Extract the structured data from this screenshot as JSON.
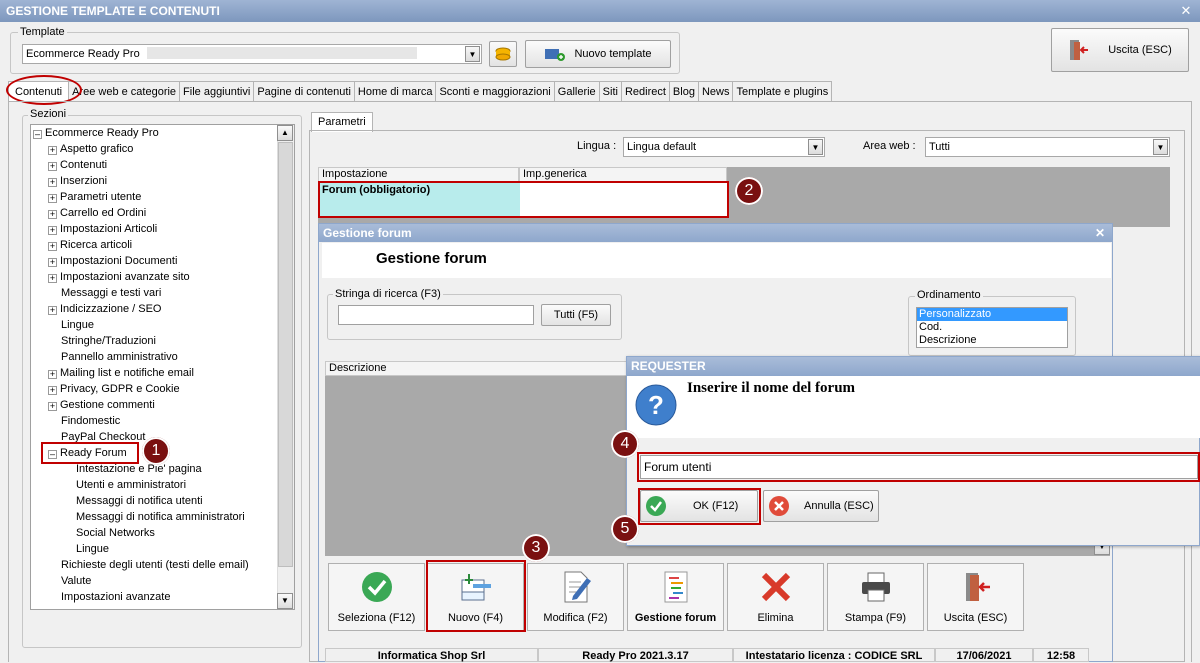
{
  "window": {
    "title": "GESTIONE TEMPLATE E CONTENUTI",
    "close": "✕"
  },
  "template": {
    "group_label": "Template",
    "selected": "Ecommerce Ready Pro",
    "new_template_label": "Nuovo template",
    "exit_label": "Uscita (ESC)"
  },
  "tabs": [
    "Contenuti",
    "Aree web e categorie",
    "File aggiuntivi",
    "Pagine di contenuti",
    "Home di marca",
    "Sconti e maggiorazioni",
    "Gallerie",
    "Siti",
    "Redirect",
    "Blog",
    "News",
    "Template e plugins"
  ],
  "sections": {
    "label": "Sezioni",
    "root": "Ecommerce Ready Pro",
    "items": [
      {
        "label": "Aspetto grafico",
        "expand": true
      },
      {
        "label": "Contenuti",
        "expand": true
      },
      {
        "label": "Inserzioni",
        "expand": true
      },
      {
        "label": "Parametri utente",
        "expand": true
      },
      {
        "label": "Carrello ed Ordini",
        "expand": true
      },
      {
        "label": "Impostazioni Articoli",
        "expand": true
      },
      {
        "label": "Ricerca articoli",
        "expand": true
      },
      {
        "label": "Impostazioni Documenti",
        "expand": true
      },
      {
        "label": "Impostazioni avanzate sito",
        "expand": true
      },
      {
        "label": "Messaggi e testi vari",
        "expand": false
      },
      {
        "label": "Indicizzazione / SEO",
        "expand": true
      },
      {
        "label": "Lingue",
        "expand": false
      },
      {
        "label": "Stringhe/Traduzioni",
        "expand": false
      },
      {
        "label": "Pannello amministrativo",
        "expand": false
      },
      {
        "label": "Mailing list e notifiche email",
        "expand": true
      },
      {
        "label": "Privacy, GDPR e Cookie",
        "expand": true
      },
      {
        "label": "Gestione commenti",
        "expand": true
      },
      {
        "label": "Findomestic",
        "expand": false
      },
      {
        "label": "PayPal Checkout",
        "expand": false
      }
    ],
    "ready_forum": "Ready Forum",
    "children": [
      "Intestazione e Pie' pagina",
      "Utenti e amministratori",
      "Messaggi di notifica utenti",
      "Messaggi di notifica amministratori",
      "Social Networks",
      "Lingue"
    ],
    "after": [
      "Richieste degli utenti (testi delle email)",
      "Valute",
      "Impostazioni avanzate"
    ]
  },
  "params": {
    "tab": "Parametri",
    "lingua_label": "Lingua :",
    "lingua_value": "Lingua default",
    "area_label": "Area web :",
    "area_value": "Tutti",
    "col1": "Impostazione",
    "col2": "Imp.generica",
    "row1": "Forum (obbligatorio)"
  },
  "forum": {
    "title": "Gestione forum",
    "heading": "Gestione forum",
    "search_label": "Stringa di ricerca (F3)",
    "all_button": "Tutti (F5)",
    "order_label": "Ordinamento",
    "order_options": [
      "Personalizzato",
      "Cod.",
      "Descrizione"
    ],
    "desc_col": "Descrizione",
    "buttons": [
      "Seleziona (F12)",
      "Nuovo (F4)",
      "Modifica (F2)",
      "Gestione forum",
      "Elimina",
      "Stampa (F9)",
      "Uscita (ESC)"
    ]
  },
  "requester": {
    "title": "REQUESTER",
    "question": "Inserire il nome del forum",
    "input_value": "Forum utenti",
    "ok": "OK (F12)",
    "cancel": "Annulla (ESC)"
  },
  "status": [
    "Informatica Shop Srl",
    "Ready Pro 2021.3.17",
    "Intestatario licenza : CODICE SRL",
    "17/06/2021",
    "12:58"
  ],
  "badges": [
    "1",
    "2",
    "3",
    "4",
    "5"
  ],
  "colors": {
    "accent_red": "#c00000",
    "badge": "#7a1010",
    "highlight_cell": "#b8ecec",
    "selected": "#3399ff"
  }
}
